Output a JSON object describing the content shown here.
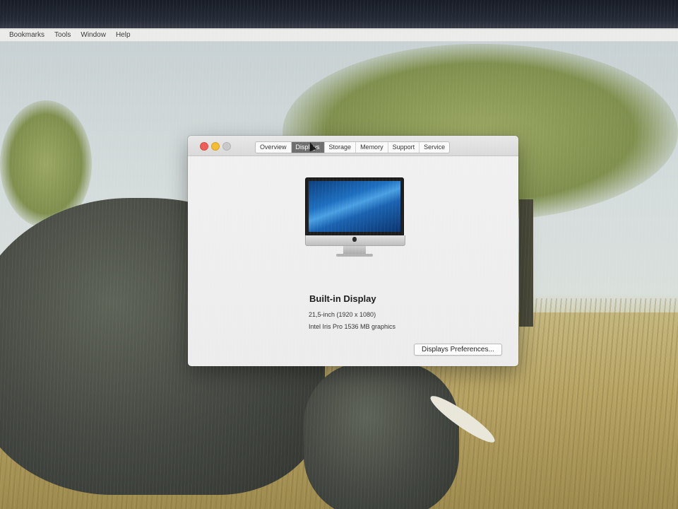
{
  "menubar": {
    "items": [
      "Bookmarks",
      "Tools",
      "Window",
      "Help"
    ]
  },
  "window": {
    "tabs": [
      {
        "label": "Overview",
        "selected": false
      },
      {
        "label": "Displays",
        "selected": true
      },
      {
        "label": "Storage",
        "selected": false
      },
      {
        "label": "Memory",
        "selected": false
      },
      {
        "label": "Support",
        "selected": false
      },
      {
        "label": "Service",
        "selected": false
      }
    ],
    "display": {
      "name": "Built-in Display",
      "size": "21,5-inch (1920 x 1080)",
      "graphics": "Intel Iris Pro 1536 MB graphics"
    },
    "preferences_button": "Displays Preferences..."
  },
  "colors": {
    "close": "#ee5c55",
    "minimize": "#f5bd2f",
    "zoom_disabled": "#c9c9c9",
    "selected_tab": "#6e6e6e"
  }
}
